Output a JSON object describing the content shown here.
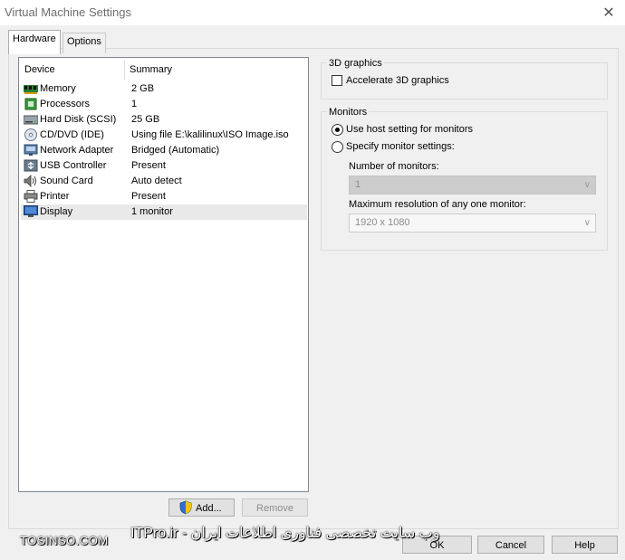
{
  "window": {
    "title": "Virtual Machine Settings",
    "close_glyph": "✕"
  },
  "tabs": [
    {
      "label": "Hardware",
      "active": true
    },
    {
      "label": "Options",
      "active": false
    }
  ],
  "device_list": {
    "headers": {
      "device": "Device",
      "summary": "Summary"
    },
    "rows": [
      {
        "icon": "memory-icon",
        "device": "Memory",
        "summary": "2 GB"
      },
      {
        "icon": "processor-icon",
        "device": "Processors",
        "summary": "1"
      },
      {
        "icon": "hard-disk-icon",
        "device": "Hard Disk (SCSI)",
        "summary": "25 GB"
      },
      {
        "icon": "cd-dvd-icon",
        "device": "CD/DVD (IDE)",
        "summary": "Using file E:\\kalilinux\\ISO Image.iso"
      },
      {
        "icon": "network-adapter-icon",
        "device": "Network Adapter",
        "summary": "Bridged (Automatic)"
      },
      {
        "icon": "usb-controller-icon",
        "device": "USB Controller",
        "summary": "Present"
      },
      {
        "icon": "sound-card-icon",
        "device": "Sound Card",
        "summary": "Auto detect"
      },
      {
        "icon": "printer-icon",
        "device": "Printer",
        "summary": "Present"
      },
      {
        "icon": "display-icon",
        "device": "Display",
        "summary": "1 monitor",
        "selected": true
      }
    ]
  },
  "buttons": {
    "add": "Add...",
    "remove": "Remove",
    "ok": "OK",
    "cancel": "Cancel",
    "help": "Help"
  },
  "graphics_group": {
    "legend": "3D graphics",
    "accelerate_label": "Accelerate 3D graphics",
    "accelerate_checked": false
  },
  "monitors_group": {
    "legend": "Monitors",
    "use_host_label": "Use host setting for monitors",
    "specify_label": "Specify monitor settings:",
    "selected_option": "use_host",
    "num_monitors_label": "Number of monitors:",
    "num_monitors_value": "1",
    "max_res_label": "Maximum resolution of any one monitor:",
    "max_res_value": "1920 x 1080"
  },
  "watermark": {
    "left": "TOSINSO.COM",
    "right": "ITPro.ir - وب سایت تخصصی فناوری اطلاعات ایران"
  },
  "colors": {
    "selection_bg": "#e9e9e9",
    "window_bg": "#f0f0f0",
    "disabled_text": "#8c8c8c"
  }
}
